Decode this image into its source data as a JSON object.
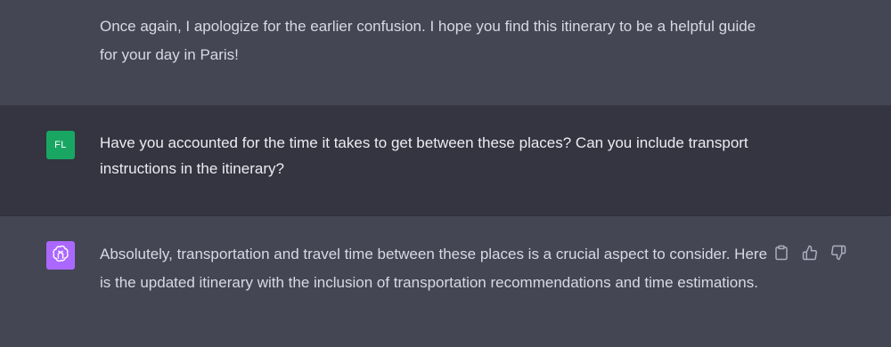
{
  "conversation": {
    "previous_assistant": {
      "text": "Once again, I apologize for the earlier confusion. I hope you find this itinerary to be a helpful guide for your day in Paris!"
    },
    "user_message": {
      "avatar_initials": "FL",
      "text": "Have you accounted for the time it takes to get between these places? Can you include transport instructions in the itinerary?"
    },
    "current_assistant": {
      "avatar_icon": "openai-logo-icon",
      "text": "Absolutely, transportation and travel time between these places is a crucial aspect to consider. Here is the updated itinerary with the inclusion of transportation recommendations and time estimations.",
      "actions": [
        "copy-icon",
        "thumbs-up-icon",
        "thumbs-down-icon"
      ]
    }
  },
  "colors": {
    "assistant_bg": "#444654",
    "user_bg": "#343541",
    "user_avatar_bg": "#19a663",
    "assistant_avatar_bg": "#ab68ff",
    "text_primary": "#ececf1",
    "text_secondary": "#d9d9e3",
    "icon_muted": "#acacbe"
  }
}
